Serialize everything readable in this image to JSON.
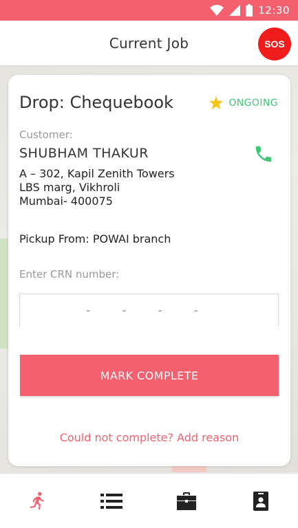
{
  "status_bar": {
    "time": "12:30",
    "icons": [
      "wifi-icon",
      "cellular-signal-icon",
      "battery-icon"
    ]
  },
  "app_bar": {
    "title": "Current Job",
    "sos_label": "SOS"
  },
  "job": {
    "title": "Drop: Chequebook",
    "status_icon": "star-icon",
    "status": "ONGOING",
    "customer_label": "Customer:",
    "customer_name": "SHUBHAM THAKUR",
    "address_line1": "A – 302, Kapil Zenith Towers",
    "address_line2": "LBS marg, Vikhroli",
    "address_line3": "Mumbai- 400075",
    "pickup": "Pickup From: POWAI branch",
    "crn_label": "Enter CRN number:",
    "crn_placeholder": "- - - -",
    "mark_complete_label": "MARK COMPLETE",
    "add_reason_label": "Could not complete? Add reason"
  },
  "bottom_nav": {
    "items": [
      "running-person-icon",
      "list-icon",
      "briefcase-icon",
      "id-badge-icon"
    ]
  },
  "colors": {
    "accent": "#f4606e",
    "sos": "#f11d1d",
    "status_green": "#3ec776",
    "star": "#f5c518"
  }
}
